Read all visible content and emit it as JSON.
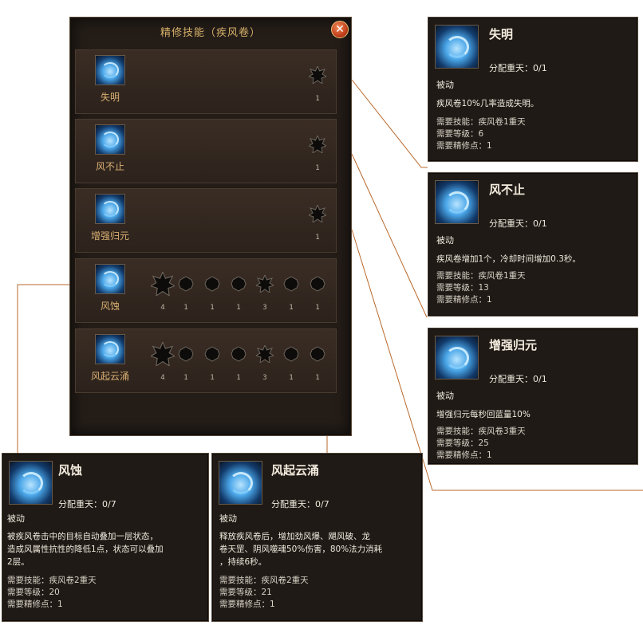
{
  "panel": {
    "title": "精修技能（疾风卷）",
    "close_glyph": "✕",
    "rows": [
      {
        "name": "失明",
        "levels": [
          "1"
        ]
      },
      {
        "name": "风不止",
        "levels": [
          "1"
        ]
      },
      {
        "name": "增强归元",
        "levels": [
          "1"
        ]
      },
      {
        "name": "风蚀",
        "levels": [
          "4",
          "1",
          "1",
          "1",
          "3",
          "1",
          "1"
        ]
      },
      {
        "name": "风起云涌",
        "levels": [
          "4",
          "1",
          "1",
          "1",
          "3",
          "1",
          "1"
        ]
      }
    ]
  },
  "tooltips": [
    {
      "name": "失明",
      "alloc": "分配重天：0/1",
      "type": "被动",
      "desc": [
        "疾风卷10%几率造成失明。"
      ],
      "req": [
        "需要技能：疾风卷1重天",
        "需要等级：6",
        "需要精修点：1"
      ]
    },
    {
      "name": "风不止",
      "alloc": "分配重天：0/1",
      "type": "被动",
      "desc": [
        "疾风卷增加1个，冷却时间增加0.3秒。"
      ],
      "req": [
        "需要技能：疾风卷1重天",
        "需要等级：13",
        "需要精修点：1"
      ]
    },
    {
      "name": "增强归元",
      "alloc": "分配重天：0/1",
      "type": "被动",
      "desc": [
        "增强归元每秒回蓝量10%"
      ],
      "req": [
        "需要技能：疾风卷3重天",
        "需要等级：25",
        "需要精修点：1"
      ]
    },
    {
      "name": "风蚀",
      "alloc": "分配重天：0/7",
      "type": "被动",
      "desc": [
        "被疾风卷击中的目标自动叠加一层状态，",
        "造成风属性抗性的降低1点，状态可以叠加",
        "2层。"
      ],
      "req": [
        "需要技能：疾风卷2重天",
        "需要等级：20",
        "需要精修点：1"
      ]
    },
    {
      "name": "风起云涌",
      "alloc": "分配重天：0/7",
      "type": "被动",
      "desc": [
        "释放疾风卷后，增加劲风爆、飓风破、龙",
        "卷天罡、阴风噬魂50%伤害，80%法力消耗",
        "，持续6秒。"
      ],
      "req": [
        "需要技能：疾风卷2重天",
        "需要等级：21",
        "需要精修点：1"
      ]
    }
  ],
  "colors": {
    "connector": "#b8692c",
    "title": "#d6b06a",
    "row_label": "#d9b072",
    "icon_blue": "#4aa6e8"
  }
}
